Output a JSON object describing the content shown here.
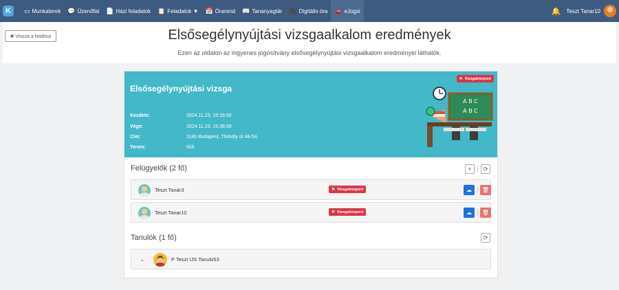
{
  "nav": {
    "logo": "K",
    "items": [
      {
        "icon": "▭",
        "label": "Munkaterek"
      },
      {
        "icon": "💬",
        "label": "Üzenőfal"
      },
      {
        "icon": "📄",
        "label": "Házi feladatok"
      },
      {
        "icon": "📋",
        "label": "Feladatok ▼"
      },
      {
        "icon": "📅",
        "label": "Órarend"
      },
      {
        "icon": "📖",
        "label": "Tananyagtár"
      },
      {
        "icon": "🎥",
        "label": "Digitális óra"
      },
      {
        "icon": "🚗",
        "label": "eJogsi"
      }
    ],
    "user": "Teszt Tanar10"
  },
  "header": {
    "back_label": "✖ Vissza a listához",
    "title": "Elsősegélynyújtási vizsgaalkalom eredmények",
    "subtitle": "Ezen az oldalon az ingyenes jogosítvány elsősegélynyújtási vizsgaalkalom eredményei láthatók."
  },
  "exam": {
    "title": "Elsősegélynyújtási vizsga",
    "badge": "Vizsgaközpont",
    "fields": [
      {
        "label": "Kezdete:",
        "value": "2024.11.23. 15:16:00"
      },
      {
        "label": "Vége:",
        "value": "2024.11.23. 15:36:00"
      },
      {
        "label": "Cím:",
        "value": "1146 Budapest, Thököly út 48-54."
      },
      {
        "label": "Terem:",
        "value": "N/A"
      }
    ],
    "board_text": [
      "A B C",
      "A B C"
    ]
  },
  "supervisors": {
    "title": "Felügyelők (2 fő)",
    "items": [
      {
        "name": "Teszt Tanár3",
        "badge": "Vizsgaközpont"
      },
      {
        "name": "Teszt Tanar10",
        "badge": "Vizsgaközpont"
      }
    ]
  },
  "students": {
    "title": "Tanulók (1 fő)",
    "items": [
      {
        "name": "P Teszt IJS Tanulo53"
      }
    ]
  },
  "colors": {
    "nav_bg": "#3d5a80",
    "banner": "#43b8c8",
    "badge": "#dc3545",
    "cloud": "#1a73e8",
    "trash": "#e57373"
  }
}
